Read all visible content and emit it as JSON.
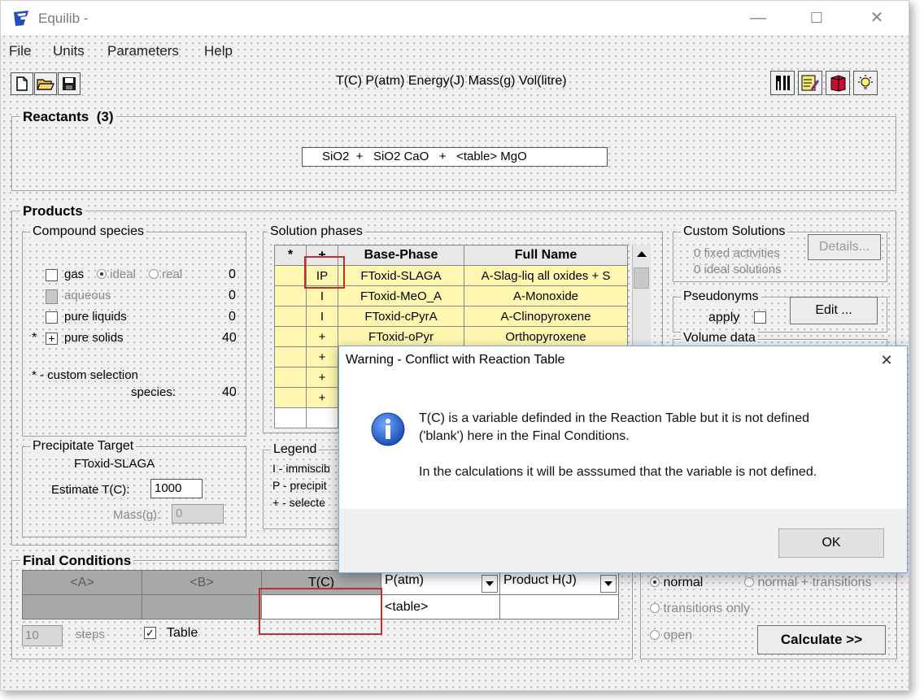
{
  "window": {
    "title": "Equilib -",
    "minimize": "—",
    "maximize": "☐",
    "close": "✕"
  },
  "menu": [
    "File",
    "Units",
    "Parameters",
    "Help"
  ],
  "units_line": "T(C) P(atm) Energy(J) Mass(g) Vol(litre)",
  "toolbar_icons": [
    "new-file-icon",
    "open-folder-icon",
    "save-icon",
    "fork-knife-icon",
    "edit-list-icon",
    "book-icon",
    "lightbulb-icon"
  ],
  "reactants": {
    "label": "Reactants",
    "count": "(3)",
    "formula": "SiO2  +   SiO2 CaO   +   <table> MgO"
  },
  "products": {
    "label": "Products"
  },
  "compound": {
    "label": "Compound species",
    "rows": [
      {
        "name": "gas",
        "opt1": "ideal",
        "opt2": "real",
        "count": "0"
      },
      {
        "name": "aqueous",
        "count": "0"
      },
      {
        "name": "pure liquids",
        "count": "0"
      },
      {
        "star": "*",
        "check": "+",
        "name": "pure solids",
        "count": "40"
      }
    ],
    "custom_note": "* - custom selection",
    "species_label": "species:",
    "species_count": "40"
  },
  "solution": {
    "label": "Solution phases",
    "headers": [
      "*",
      "+",
      "Base-Phase",
      "Full Name"
    ],
    "rows": [
      {
        "star": "",
        "plus": "IP",
        "base": "FToxid-SLAGA",
        "full": "A-Slag-liq all oxides + S"
      },
      {
        "star": "",
        "plus": "I",
        "base": "FToxid-MeO_A",
        "full": "A-Monoxide"
      },
      {
        "star": "",
        "plus": "I",
        "base": "FToxid-cPyrA",
        "full": "A-Clinopyroxene"
      },
      {
        "star": "",
        "plus": "+",
        "base": "FToxid-oPyr",
        "full": "Orthopyroxene"
      },
      {
        "star": "",
        "plus": "+",
        "base": "",
        "full": ""
      },
      {
        "star": "",
        "plus": "+",
        "base": "",
        "full": ""
      },
      {
        "star": "",
        "plus": "+",
        "base": "",
        "full": ""
      }
    ]
  },
  "custom_solutions": {
    "label": "Custom Solutions",
    "fixed": "0  fixed activities",
    "ideal": "0  ideal solutions",
    "details": "Details..."
  },
  "pseudonyms": {
    "label": "Pseudonyms",
    "apply": "apply",
    "edit": "Edit ..."
  },
  "volume_data": {
    "label": "Volume data"
  },
  "precipitate": {
    "label": "Precipitate Target",
    "phase": "FToxid-SLAGA",
    "estimate_label": "Estimate T(C):",
    "estimate_value": "1000",
    "mass_label": "Mass(g):",
    "mass_value": "0"
  },
  "legend": {
    "label": "Legend",
    "lines": [
      "I - immiscib",
      "P - precipit",
      "+ - selecte"
    ]
  },
  "final": {
    "label": "Final Conditions",
    "headers": [
      "<A>",
      "<B>",
      "T(C)",
      "P(atm)",
      "Product H(J)"
    ],
    "values": [
      "",
      "",
      "",
      "<table>",
      ""
    ],
    "steps_value": "10",
    "steps_label": "steps",
    "table_label": "Table"
  },
  "calc": {
    "normal": "normal",
    "normal_trans": "normal + transitions",
    "trans_only": "transitions only",
    "open": "open",
    "calculate": "Calculate >>"
  },
  "dialog": {
    "title": "Warning - Conflict with Reaction Table",
    "close": "✕",
    "line1": "T(C) is a variable definded in the Reaction Table but it is not defined",
    "line2": "('blank') here in the Final Conditions.",
    "line3": "In the calculations it will be asssumed that the variable is not defined.",
    "ok": "OK"
  }
}
